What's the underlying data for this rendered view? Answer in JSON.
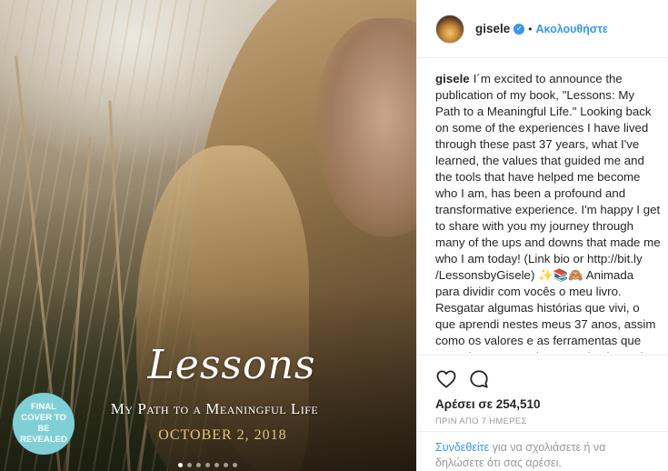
{
  "photo": {
    "title": "Lessons",
    "subtitle": "My Path to a Meaningful Life",
    "date": "OCTOBER 2, 2018",
    "badge": "FINAL COVER TO BE REVEALED",
    "carousel_dots": 7,
    "active_dot": 0
  },
  "header": {
    "username": "gisele",
    "verified": true,
    "separator": "•",
    "follow_label": "Ακολουθήστε"
  },
  "caption": {
    "username": "gisele",
    "text": "I´m excited to announce the publication of my book, \"Lessons: My Path to a Meaningful Life.\" Looking back on some of the experiences I have lived through these past 37 years, what I've learned, the values that guided me and the tools that have helped me become who I am, has been a profound and transformative experience. I'm happy I get to share with you my journey through many of the ups and downs that made me who I am today! (Link bio or http://bit.ly /LessonsbyGisele) ✨📚🙈 Animada para dividir com vocês o meu livro. Resgatar algumas histórias que vivi, o que aprendi nestes meus 37 anos, assim como os valores e as ferramentas que me guiaram para chegar onde cheguei tem sido uma experiência profunda e transformadora. Fico feliz em poder compartilhar um pouco desta"
  },
  "actions": {
    "likes_text": "Αρέσει σε 254,510",
    "time_text": "ΠΡΙΝ ΑΠΟ 7 ΗΜΕΡΕΣ"
  },
  "comment": {
    "login_label": "Συνδεθείτε",
    "rest_text": " για να σχολιάσετε ή να δηλώσετε ότι σας αρέσει."
  },
  "colors": {
    "accent": "#3897f0",
    "badge": "#7fd0d6",
    "date": "#e3c47a",
    "muted": "#999999"
  }
}
